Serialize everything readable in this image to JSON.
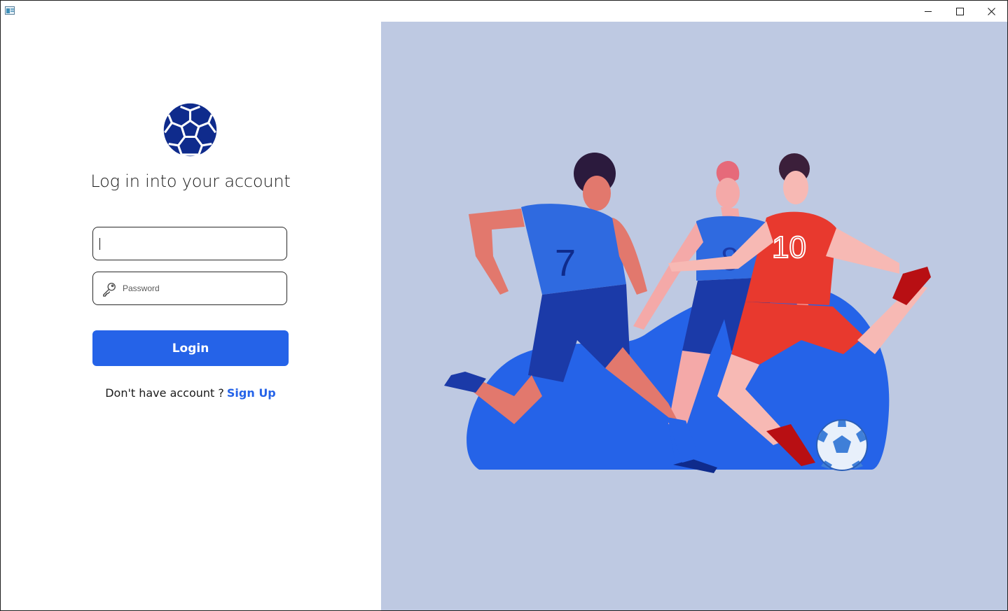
{
  "window": {
    "controls": {
      "minimize": "minimize",
      "maximize": "maximize",
      "close": "close"
    }
  },
  "login": {
    "heading": "Log in into your account",
    "username": {
      "value": "",
      "placeholder": ""
    },
    "password": {
      "value": "",
      "placeholder": "Password"
    },
    "login_label": "Login",
    "signup_prompt": "Don't have account ?",
    "signup_link": "Sign Up"
  },
  "illustration": {
    "jersey_numbers": [
      "7",
      "8",
      "10"
    ]
  },
  "colors": {
    "accent": "#2563e8",
    "logo": "#0f2b8c",
    "illustration_bg": "#bec9e2",
    "blue_team": "#2f6ae0",
    "red_team": "#e8392e"
  },
  "icons": {
    "app": "app-window-icon",
    "logo": "soccer-ball-icon",
    "password": "key-icon"
  }
}
